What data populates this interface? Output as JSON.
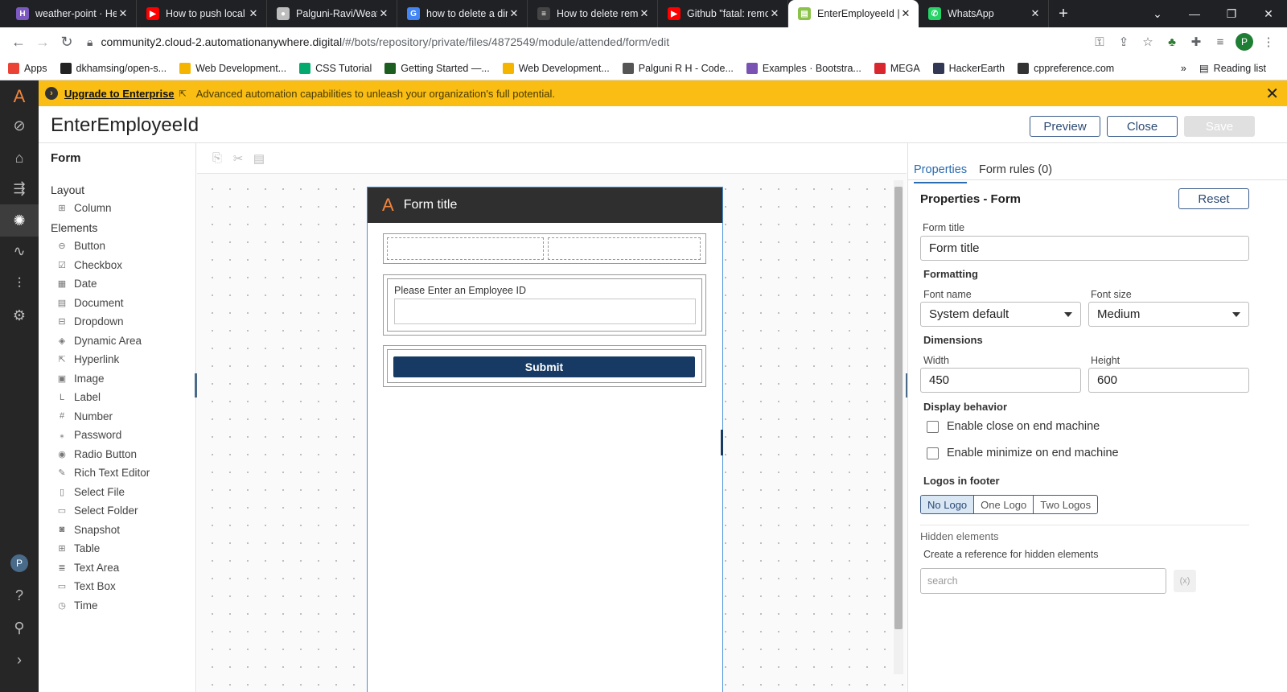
{
  "browser": {
    "tabs": [
      {
        "title": "weather-point · He",
        "fav_color": "#7b59c0",
        "fav_text": "H"
      },
      {
        "title": "How to push local",
        "fav_color": "#ff0000",
        "fav_text": "▶"
      },
      {
        "title": "Palguni-Ravi/Weat",
        "fav_color": "#bdbdbd",
        "fav_text": "●"
      },
      {
        "title": "how to delete a dir",
        "fav_color": "#4285f4",
        "fav_text": "G"
      },
      {
        "title": "How to delete rem",
        "fav_color": "#444444",
        "fav_text": "≡"
      },
      {
        "title": "Github \"fatal: remo",
        "fav_color": "#ff0000",
        "fav_text": "▶"
      },
      {
        "title": "EnterEmployeeId |",
        "fav_color": "#8bc34a",
        "fav_text": "▤",
        "active": true
      },
      {
        "title": "WhatsApp",
        "fav_color": "#25d366",
        "fav_text": "✆"
      }
    ],
    "url_host": "community2.cloud-2.automationanywhere.digital",
    "url_path": "/#/bots/repository/private/files/4872549/module/attended/form/edit",
    "profile_initial": "P",
    "bookmarks": [
      {
        "label": "Apps",
        "color": "#ea4335"
      },
      {
        "label": "dkhamsing/open-s...",
        "color": "#222222"
      },
      {
        "label": "Web Development...",
        "color": "#f4b400"
      },
      {
        "label": "CSS Tutorial",
        "color": "#04aa6d"
      },
      {
        "label": "Getting Started —...",
        "color": "#1b5e20"
      },
      {
        "label": "Web Development...",
        "color": "#f4b400"
      },
      {
        "label": "Palguni R H - Code...",
        "color": "#555555"
      },
      {
        "label": "Examples · Bootstra...",
        "color": "#7952b3"
      },
      {
        "label": "MEGA",
        "color": "#d9272e"
      },
      {
        "label": "HackerEarth",
        "color": "#323754"
      },
      {
        "label": "cppreference.com",
        "color": "#333333"
      }
    ],
    "reading_list": "Reading list"
  },
  "banner": {
    "link": "Upgrade to Enterprise",
    "text": "Advanced automation capabilities to unleash your organization's full potential."
  },
  "header": {
    "title": "EnterEmployeeId",
    "preview": "Preview",
    "close": "Close",
    "save": "Save"
  },
  "palette": {
    "title": "Form",
    "layout_heading": "Layout",
    "layout_items": [
      {
        "label": "Column",
        "icon": "⊞"
      }
    ],
    "elements_heading": "Elements",
    "elements": [
      {
        "label": "Button",
        "icon": "⊖"
      },
      {
        "label": "Checkbox",
        "icon": "☑"
      },
      {
        "label": "Date",
        "icon": "▦"
      },
      {
        "label": "Document",
        "icon": "▤"
      },
      {
        "label": "Dropdown",
        "icon": "⊟"
      },
      {
        "label": "Dynamic Area",
        "icon": "◈"
      },
      {
        "label": "Hyperlink",
        "icon": "⇱"
      },
      {
        "label": "Image",
        "icon": "▣"
      },
      {
        "label": "Label",
        "icon": "L"
      },
      {
        "label": "Number",
        "icon": "#"
      },
      {
        "label": "Password",
        "icon": "⁎"
      },
      {
        "label": "Radio Button",
        "icon": "◉"
      },
      {
        "label": "Rich Text Editor",
        "icon": "✎"
      },
      {
        "label": "Select File",
        "icon": "▯"
      },
      {
        "label": "Select Folder",
        "icon": "▭"
      },
      {
        "label": "Snapshot",
        "icon": "◙"
      },
      {
        "label": "Table",
        "icon": "⊞"
      },
      {
        "label": "Text Area",
        "icon": "≣"
      },
      {
        "label": "Text Box",
        "icon": "▭"
      },
      {
        "label": "Time",
        "icon": "◷"
      }
    ]
  },
  "form": {
    "title": "Form title",
    "field_label": "Please Enter an Employee ID",
    "field_value": "",
    "submit": "Submit"
  },
  "properties": {
    "tab_properties": "Properties",
    "tab_rules": "Form rules (0)",
    "heading": "Properties - Form",
    "reset": "Reset",
    "form_title_label": "Form title",
    "form_title_value": "Form title",
    "formatting": "Formatting",
    "font_name_label": "Font name",
    "font_name_value": "System default",
    "font_size_label": "Font size",
    "font_size_value": "Medium",
    "dimensions": "Dimensions",
    "width_label": "Width",
    "width_value": "450",
    "height_label": "Height",
    "height_value": "600",
    "display_behavior": "Display behavior",
    "enable_close": "Enable close on end machine",
    "enable_minimize": "Enable minimize on end machine",
    "logos_footer": "Logos in footer",
    "logo_options": [
      "No Logo",
      "One Logo",
      "Two Logos"
    ],
    "logo_selected": "No Logo",
    "hidden_elements": "Hidden elements",
    "hidden_desc": "Create a reference for hidden elements",
    "search_placeholder": "search",
    "fx_label": "(x)"
  }
}
